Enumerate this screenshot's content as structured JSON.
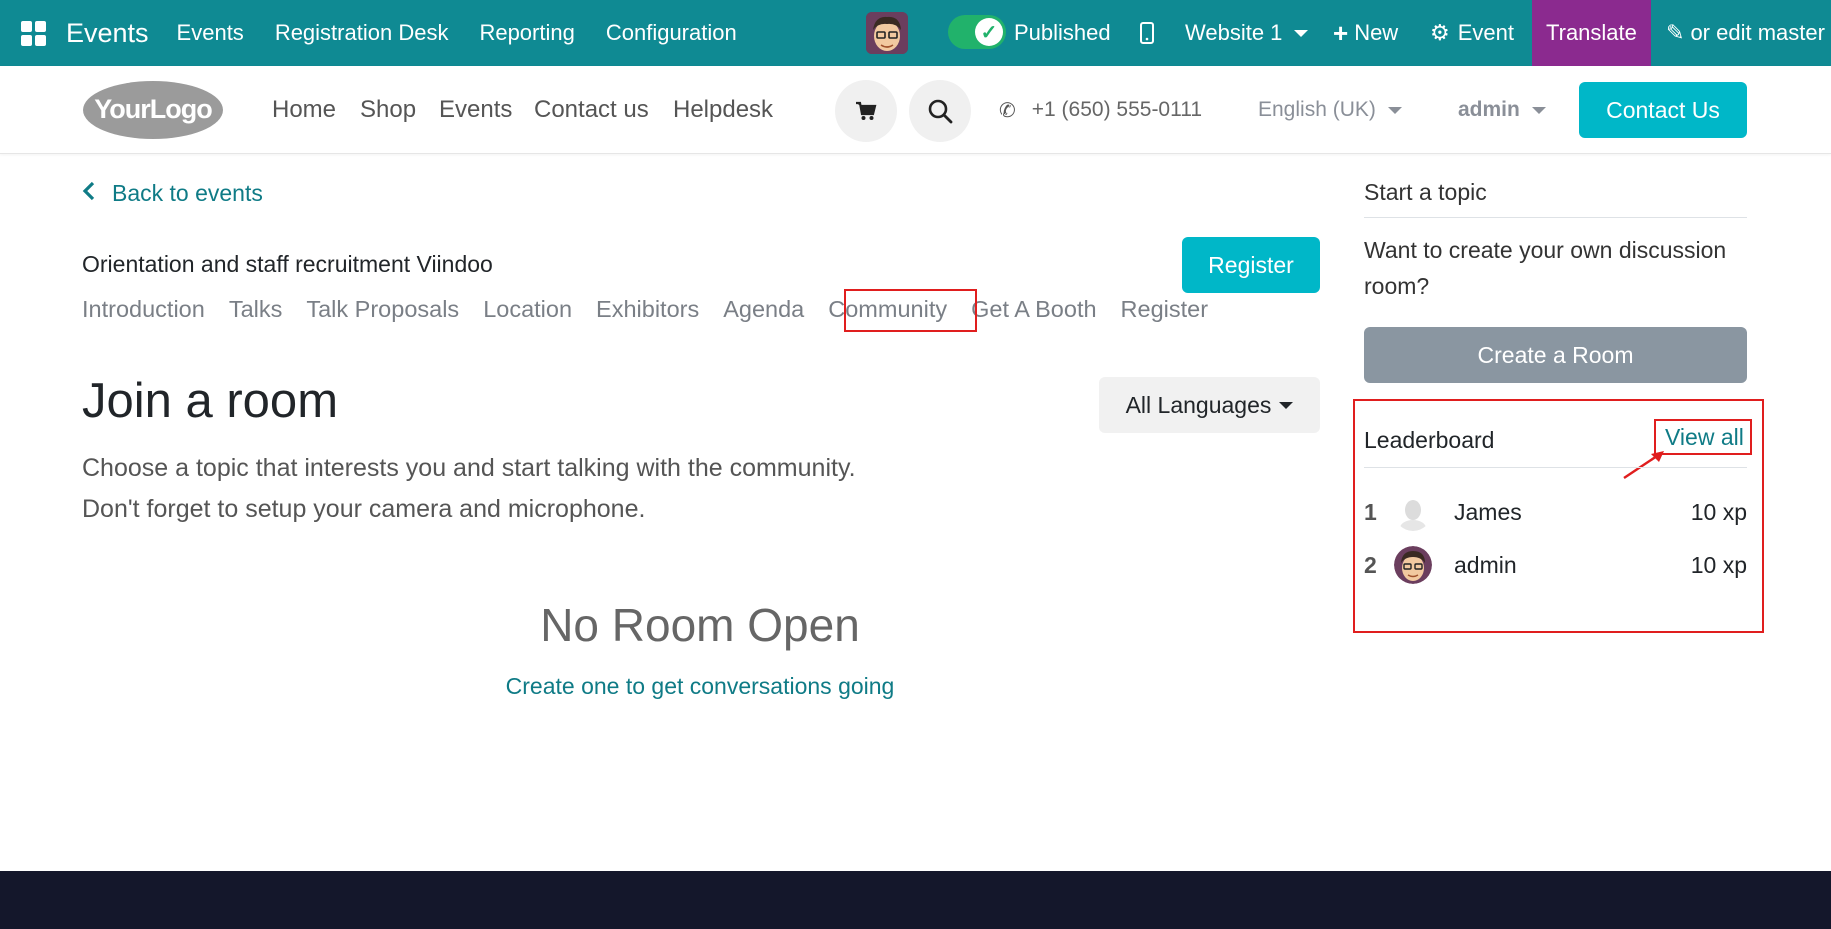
{
  "topbar": {
    "app_name": "Events",
    "menus": [
      "Events",
      "Registration Desk",
      "Reporting",
      "Configuration"
    ],
    "published_label": "Published",
    "website_label": "Website 1",
    "new_label": "New",
    "event_label": "Event",
    "translate_label": "Translate",
    "edit_label": "or edit master"
  },
  "header": {
    "logo_text": "YourLogo",
    "nav": [
      "Home",
      "Shop",
      "Events",
      "Contact us",
      "Helpdesk"
    ],
    "phone": "+1 (650) 555-0111",
    "language": "English (UK)",
    "user": "admin",
    "contact_button": "Contact Us"
  },
  "main": {
    "back_link": "Back to events",
    "event_title": "Orientation and staff recruitment Viindoo",
    "register_button": "Register",
    "tabs": [
      "Introduction",
      "Talks",
      "Talk Proposals",
      "Location",
      "Exhibitors",
      "Agenda",
      "Community",
      "Get A Booth",
      "Register"
    ],
    "heading": "Join a room",
    "language_filter": "All Languages",
    "description_line1": "Choose a topic that interests you and start talking with the community.",
    "description_line2": "Don't forget to setup your camera and microphone.",
    "empty_title": "No Room Open",
    "empty_link": "Create one to get conversations going"
  },
  "sidebar": {
    "start_topic": "Start a topic",
    "prompt": "Want to create your own discussion room?",
    "create_room_button": "Create a Room",
    "leaderboard_title": "Leaderboard",
    "view_all": "View all",
    "leaders": [
      {
        "rank": "1",
        "name": "James",
        "xp": "10 xp"
      },
      {
        "rank": "2",
        "name": "admin",
        "xp": "10 xp"
      }
    ]
  },
  "colors": {
    "topbar": "#0f8a93",
    "accent": "#00b7c8",
    "translate": "#8b2a8f",
    "highlight": "#e01e1e",
    "footer": "#14172b"
  }
}
